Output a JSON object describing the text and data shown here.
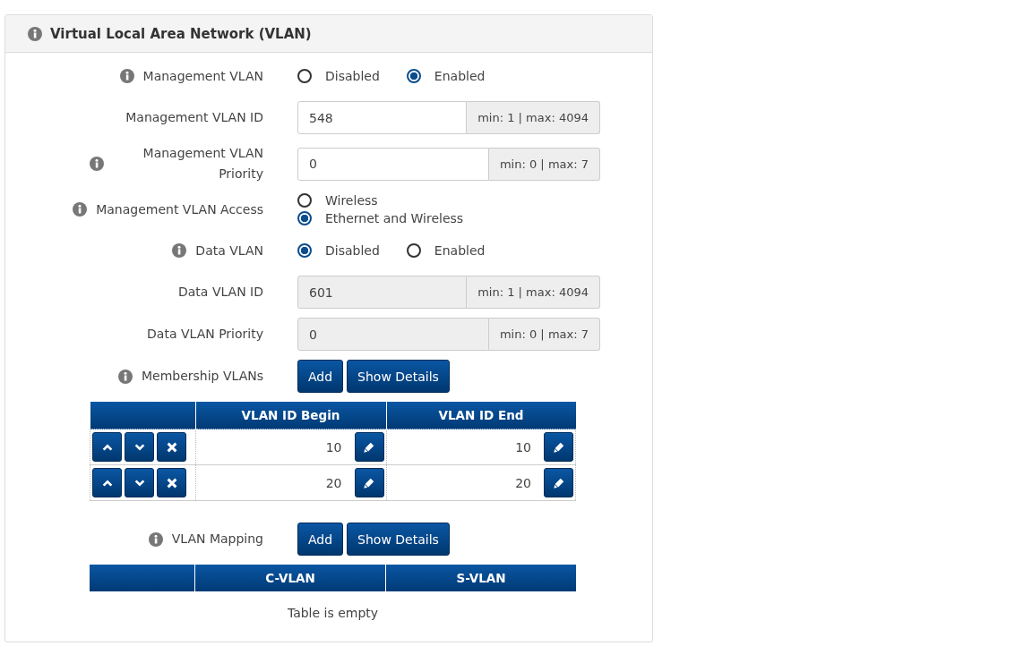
{
  "panel": {
    "title": "Virtual Local Area Network (VLAN)",
    "info": true
  },
  "fields": [
    {
      "kind": "radio",
      "label": "Management VLAN",
      "info": true,
      "options": [
        {
          "label": "Disabled",
          "selected": false
        },
        {
          "label": "Enabled",
          "selected": true
        }
      ]
    },
    {
      "kind": "number",
      "label": "Management VLAN ID",
      "info": false,
      "value": "548",
      "hint": "min: 1 | max: 4094",
      "disabled": false
    },
    {
      "kind": "number",
      "label": "Management VLAN Priority",
      "info": true,
      "value": "0",
      "hint": "min: 0 | max: 7",
      "disabled": false
    },
    {
      "kind": "radio-stack",
      "label": "Management VLAN Access",
      "info": true,
      "options": [
        {
          "label": "Wireless",
          "selected": false
        },
        {
          "label": "Ethernet and Wireless",
          "selected": true
        }
      ]
    },
    {
      "kind": "radio",
      "label": "Data VLAN",
      "info": true,
      "options": [
        {
          "label": "Disabled",
          "selected": true
        },
        {
          "label": "Enabled",
          "selected": false
        }
      ]
    },
    {
      "kind": "number",
      "label": "Data VLAN ID",
      "info": false,
      "value": "601",
      "hint": "min: 1 | max: 4094",
      "disabled": true
    },
    {
      "kind": "number",
      "label": "Data VLAN Priority",
      "info": false,
      "value": "0",
      "hint": "min: 0 | max: 7",
      "disabled": true
    },
    {
      "kind": "table",
      "label": "Membership VLANs",
      "info": true,
      "buttons": [
        "Add",
        "Show Details"
      ],
      "columns": [
        "VLAN ID Begin",
        "VLAN ID End"
      ],
      "rows": [
        {
          "values": [
            "10",
            "10"
          ]
        },
        {
          "values": [
            "20",
            "20"
          ]
        }
      ]
    },
    {
      "kind": "table",
      "label": "VLAN Mapping",
      "info": true,
      "buttons": [
        "Add",
        "Show Details"
      ],
      "columns": [
        "C-VLAN",
        "S-VLAN"
      ],
      "empty_text": "Table is empty"
    }
  ]
}
